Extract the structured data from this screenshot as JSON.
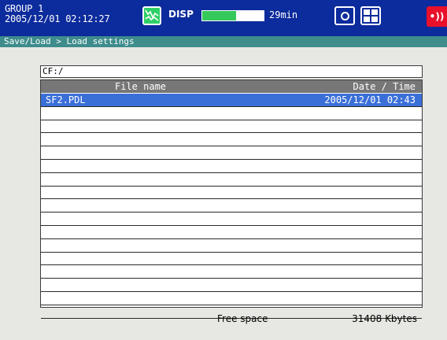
{
  "status": {
    "group": "GROUP 1",
    "datetime": "2005/12/01 02:12:27",
    "disp_label": "DISP",
    "memory_fill_percent": 55,
    "memory_time": "29min",
    "icons": {
      "trend": "trend-icon",
      "camera": "camera-icon",
      "calc": "calc-icon",
      "alarm": "alarm-icon"
    },
    "alarm_glyph": "•))",
    "colors": {
      "bar_bg": "#0c2b9c",
      "memory_fill": "#35c85a",
      "alarm": "#e8102a"
    }
  },
  "breadcrumb": "Save/Load > Load settings",
  "path": "CF:/",
  "table": {
    "headers": {
      "name": "File name",
      "date": "Date / Time"
    },
    "rows": [
      {
        "name": "SF2.PDL",
        "date": "2005/12/01 02:43"
      }
    ],
    "empty_rows": 16
  },
  "free_space": {
    "label": "Free space",
    "value": "31408 Kbytes"
  }
}
